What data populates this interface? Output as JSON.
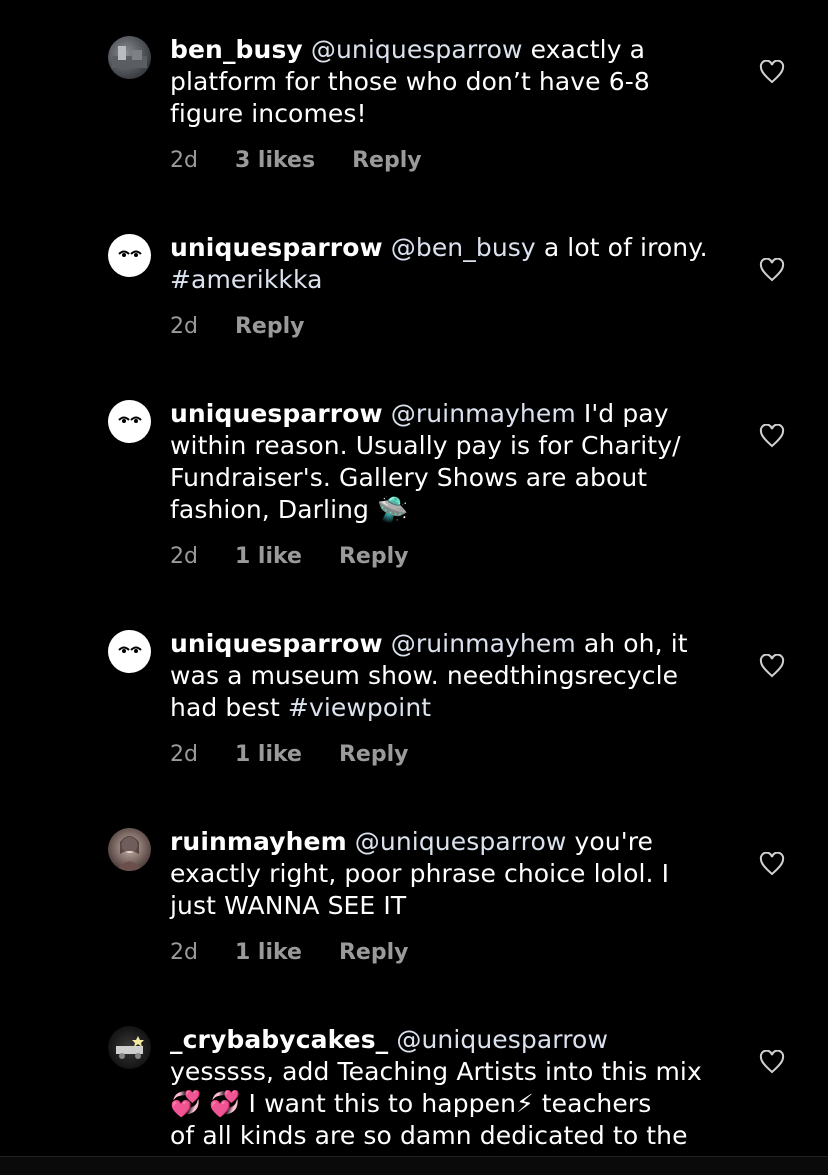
{
  "comments": [
    {
      "username": "ben_busy",
      "mention": "@uniquesparrow",
      "lines": [
        "exactly a",
        "platform for those who don’t have 6-8",
        "figure incomes!"
      ],
      "age": "2d",
      "likes": "3 likes",
      "reply": "Reply"
    },
    {
      "username": "uniquesparrow",
      "mention": "@ben_busy",
      "text_after": "a lot of irony.",
      "hashtag": "#amerikkka",
      "age": "2d",
      "reply": "Reply"
    },
    {
      "username": "uniquesparrow",
      "mention": "@ruinmayhem",
      "lines": [
        "I'd pay",
        "within reason. Usually pay is for Charity/",
        "Fundraiser's. Gallery Shows are about",
        "fashion, Darling 🛸"
      ],
      "age": "2d",
      "likes": "1 like",
      "reply": "Reply"
    },
    {
      "username": "uniquesparrow",
      "mention": "@ruinmayhem",
      "lines": [
        "ah oh, it",
        "was a museum show. needthingsrecycle",
        "had best"
      ],
      "hashtag": "#viewpoint",
      "age": "2d",
      "likes": "1 like",
      "reply": "Reply"
    },
    {
      "username": "ruinmayhem",
      "mention": "@uniquesparrow",
      "lines": [
        "you're",
        "exactly right, poor phrase choice lolol. I",
        "just WANNA SEE IT"
      ],
      "age": "2d",
      "likes": "1 like",
      "reply": "Reply"
    },
    {
      "username": "_crybabycakes_",
      "mention": "@uniquesparrow",
      "lines": [
        "yesssss, add Teaching Artists into this mix",
        "💞 💞  I want this to happen⚡  teachers",
        "of all kinds are so damn dedicated to the"
      ]
    }
  ],
  "icons": {
    "like": "heart-outline-icon"
  }
}
